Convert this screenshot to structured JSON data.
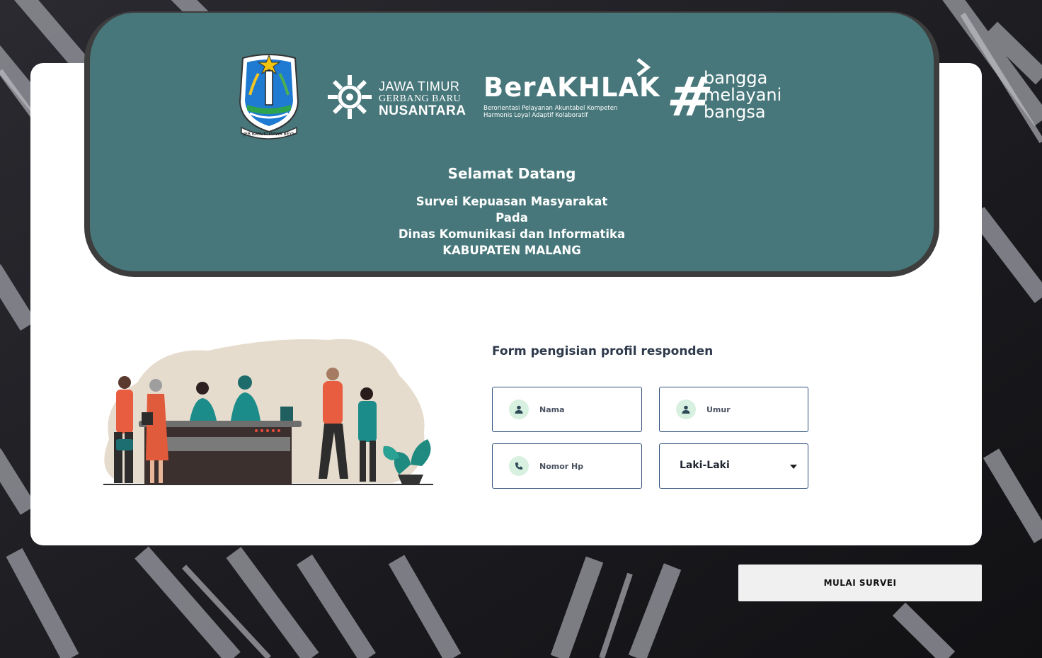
{
  "header": {
    "logos": {
      "seal_text": "JER BASUKI MAWA BEYA",
      "jatim_line1": "JAWA TIMUR",
      "jatim_line2": "GERBANG BARU",
      "jatim_line3": "NUSANTARA",
      "berakhlak_title": "BerAKHLAK",
      "berakhlak_sub1": "Berorientasi Pelayanan Akuntabel Kompeten",
      "berakhlak_sub2": "Harmonis Loyal Adaptif Kolaboratif",
      "bangga_hash": "#",
      "bangga_line1": "bangga",
      "bangga_line2": "melayani",
      "bangga_line3": "bangsa"
    },
    "welcome_title": "Selamat Datang",
    "line1": "Survei Kepuasan Masyarakat",
    "line2": "Pada",
    "line3": "Dinas Komunikasi dan Informatika",
    "line4": "KABUPATEN MALANG"
  },
  "form": {
    "title": "Form pengisian profil responden",
    "nama_placeholder": "Nama",
    "umur_placeholder": "Umur",
    "hp_placeholder": "Nomor Hp",
    "gender_selected": "Laki-Laki"
  },
  "start_button": "MULAI SURVEI",
  "colors": {
    "header_bg": "#47777a",
    "header_border": "#3d3d3d",
    "field_border": "#2f4f7a",
    "icon_bg": "#d8f0df",
    "button_bg": "#f0f0f0"
  },
  "icons": {
    "nama": "user-icon",
    "umur": "user-icon",
    "hp": "phone-icon",
    "gender": "chevron-down-icon"
  }
}
